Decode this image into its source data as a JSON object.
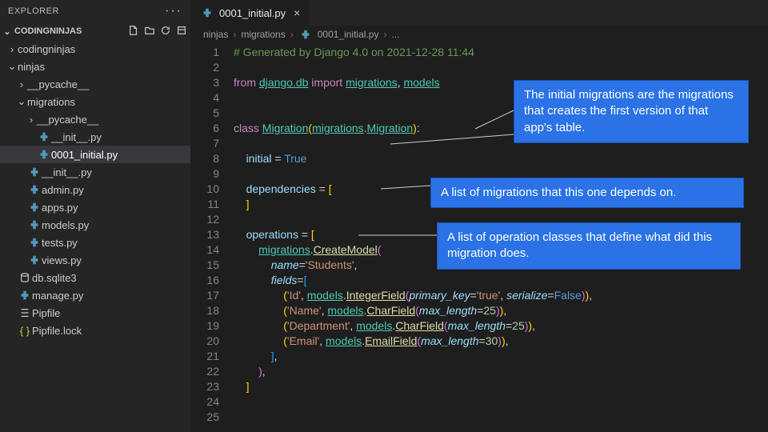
{
  "sidebar": {
    "header": "EXPLORER",
    "section": "CODINGNINJAS",
    "tree": [
      {
        "depth": 0,
        "kind": "folder",
        "open": false,
        "label": "codingninjas"
      },
      {
        "depth": 0,
        "kind": "folder",
        "open": true,
        "label": "ninjas"
      },
      {
        "depth": 1,
        "kind": "folder",
        "open": false,
        "label": "__pycache__"
      },
      {
        "depth": 1,
        "kind": "folder",
        "open": true,
        "label": "migrations"
      },
      {
        "depth": 2,
        "kind": "folder",
        "open": false,
        "label": "__pycache__"
      },
      {
        "depth": 2,
        "kind": "py",
        "label": "__init__.py"
      },
      {
        "depth": 2,
        "kind": "py",
        "label": "0001_initial.py",
        "selected": true
      },
      {
        "depth": 1,
        "kind": "py",
        "label": "__init__.py"
      },
      {
        "depth": 1,
        "kind": "py",
        "label": "admin.py"
      },
      {
        "depth": 1,
        "kind": "py",
        "label": "apps.py"
      },
      {
        "depth": 1,
        "kind": "py",
        "label": "models.py"
      },
      {
        "depth": 1,
        "kind": "py",
        "label": "tests.py"
      },
      {
        "depth": 1,
        "kind": "py",
        "label": "views.py"
      },
      {
        "depth": 0,
        "kind": "db",
        "label": "db.sqlite3"
      },
      {
        "depth": 0,
        "kind": "py",
        "label": "manage.py"
      },
      {
        "depth": 0,
        "kind": "pip",
        "label": "Pipfile"
      },
      {
        "depth": 0,
        "kind": "json",
        "label": "Pipfile.lock"
      }
    ]
  },
  "tab": {
    "icon": "py",
    "label": "0001_initial.py"
  },
  "breadcrumb": [
    "ninjas",
    "migrations",
    "0001_initial.py",
    "..."
  ],
  "annotations": [
    {
      "text": "The initial migrations are the migrations that creates the first version of that app's table."
    },
    {
      "text": "A list of migrations that this one depends on."
    },
    {
      "text": "A list of operation classes that define what did this migration does."
    }
  ],
  "code": {
    "comment": "# Generated by Django 4.0 on 2021-12-28 11:44",
    "from": "from",
    "django_db": "django.db",
    "import": "import",
    "migrations": "migrations",
    "models": "models",
    "class": "class",
    "Migration": "Migration",
    "initial": "initial",
    "True": "True",
    "dependencies": "dependencies",
    "operations": "operations",
    "CreateModel": "CreateModel",
    "name": "name",
    "Students": "'Students'",
    "fields": "fields",
    "Id": "'Id'",
    "IntegerField": "IntegerField",
    "primary_key": "primary_key",
    "true_str": "'true'",
    "serialize": "serialize",
    "False": "False",
    "Name": "'Name'",
    "CharField": "CharField",
    "max_length": "max_length",
    "n25": "25",
    "Department": "'Department'",
    "Email": "'Email'",
    "EmailField": "EmailField",
    "n30": "30"
  }
}
